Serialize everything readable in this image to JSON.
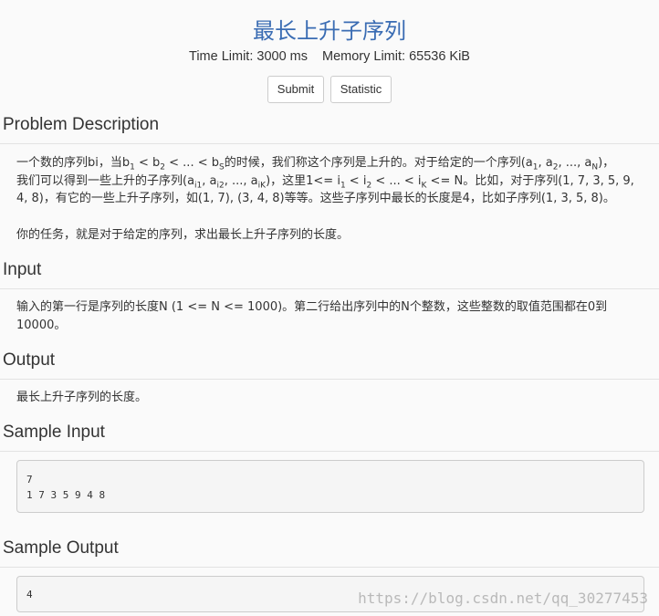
{
  "problem": {
    "title": "最长上升子序列",
    "time_limit": "Time Limit: 3000 ms",
    "memory_limit": "Memory Limit: 65536 KiB"
  },
  "buttons": {
    "submit": "Submit",
    "statistic": "Statistic"
  },
  "sections": {
    "description": "Problem Description",
    "input": "Input",
    "output": "Output",
    "sample_input": "Sample Input",
    "sample_output": "Sample Output"
  },
  "description": {
    "l1_a": "一个数的序列bi，当b",
    "l1_s1": "1",
    "l1_b": " < b",
    "l1_s2": "2",
    "l1_c": " < ... < b",
    "l1_s3": "S",
    "l1_d": "的时候，我们称这个序列是上升的。对于给定的一个序列(a",
    "l1_s4": "1",
    "l1_e": ", a",
    "l1_s5": "2",
    "l1_f": ", ..., a",
    "l1_s6": "N",
    "l1_g": ")，",
    "l2_a": "我们可以得到一些上升的子序列(a",
    "l2_s1": "i1",
    "l2_b": ", a",
    "l2_s2": "i2",
    "l2_c": ", ..., a",
    "l2_s3": "iK",
    "l2_d": ")，这里1<= i",
    "l2_s4": "1",
    "l2_e": " < i",
    "l2_s5": "2",
    "l2_f": " < ... < i",
    "l2_s6": "K",
    "l2_g": " <= N。比如，对于序列(1, 7, 3, 5, 9,",
    "l3": "4, 8)，有它的一些上升子序列，如(1, 7), (3, 4, 8)等等。这些子序列中最长的长度是4，比如子序列(1, 3, 5, 8)。",
    "task": "你的任务，就是对于给定的序列，求出最长上升子序列的长度。"
  },
  "input_text": "输入的第一行是序列的长度N (1 <= N <= 1000)。第二行给出序列中的N个整数，这些整数的取值范围都在0到10000。",
  "output_text": "最长上升子序列的长度。",
  "sample_input": "7\n1 7 3 5 9 4 8",
  "sample_output": "4",
  "watermark": "https://blog.csdn.net/qq_30277453"
}
